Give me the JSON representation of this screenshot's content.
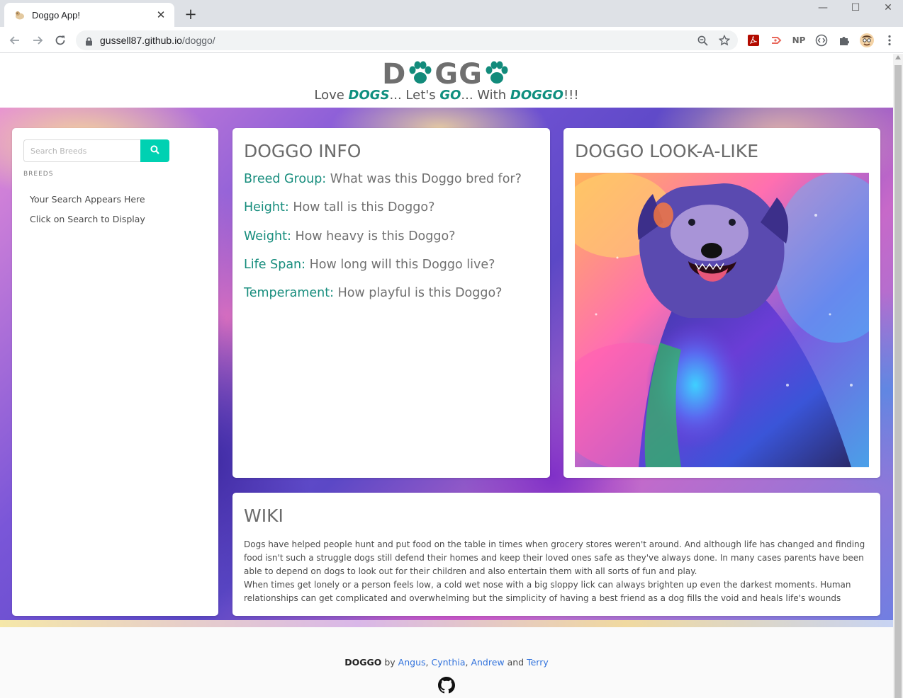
{
  "browser": {
    "tab_title": "Doggo App!",
    "tab_close": "✕",
    "new_tab": "+",
    "url_host": "gussell87.github.io",
    "url_path": "/doggo/",
    "ext_np": "NP",
    "win_minimize": "—",
    "win_maximize": "☐",
    "win_close": "✕"
  },
  "header": {
    "logo_prefix": "D",
    "logo_middle": "GG",
    "tagline_1": "Love ",
    "tagline_dogs": "DOGS",
    "tagline_2": "... Let's ",
    "tagline_go": "GO",
    "tagline_3": "... With ",
    "tagline_doggo": "DOGGO",
    "tagline_4": "!!!"
  },
  "sidebar": {
    "search_placeholder": "Search Breeds",
    "breeds_label": "BREEDS",
    "items": [
      "Your Search Appears Here",
      "Click on Search to Display"
    ]
  },
  "info": {
    "title": "DOGGO INFO",
    "rows": [
      {
        "key": "Breed Group:",
        "value": " What was this Doggo bred for?"
      },
      {
        "key": "Height:",
        "value": " How tall is this Doggo?"
      },
      {
        "key": "Weight:",
        "value": " How heavy is this Doggo?"
      },
      {
        "key": "Life Span:",
        "value": " How long will this Doggo live?"
      },
      {
        "key": "Temperament:",
        "value": " How playful is this Doggo?"
      }
    ]
  },
  "lookalike": {
    "title": "DOGGO LOOK-A-LIKE"
  },
  "wiki": {
    "title": "WIKI",
    "paragraph_1": "Dogs have helped people hunt and put food on the table in times when grocery stores weren't around. And although life has changed and finding food isn't such a struggle dogs still defend their homes and keep their loved ones safe as they've always done. In many cases parents have been able to depend on dogs to look out for their children and also entertain them with all sorts of fun and play.",
    "paragraph_2": "When times get lonely or a person feels low, a cold wet nose with a big sloppy lick can always brighten up even the darkest moments. Human relationships can get complicated and overwhelming but the simplicity of having a best friend as a dog fills the void and heals life's wounds"
  },
  "footer": {
    "brand": "DOGGO",
    "by": " by ",
    "authors": [
      "Angus",
      "Cynthia",
      "Andrew",
      "Terry"
    ],
    "sep": ", ",
    "and": " and "
  },
  "colors": {
    "accent": "#00d1b2",
    "teal_text": "#178d7d",
    "link": "#3273dc"
  }
}
